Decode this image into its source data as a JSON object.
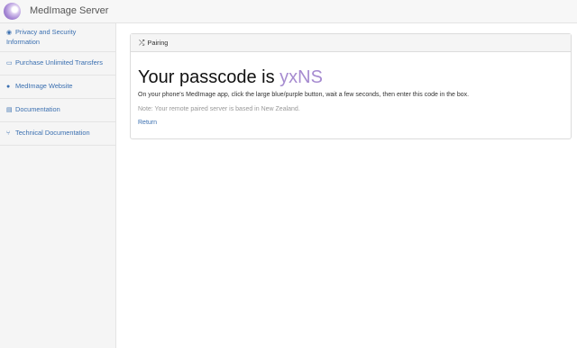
{
  "app": {
    "title": "MedImage Server"
  },
  "sidebar": {
    "items": [
      {
        "icon": "eye-icon",
        "label": "Privacy and Security Information"
      },
      {
        "icon": "credit-card-icon",
        "label": "Purchase Unlimited Transfers"
      },
      {
        "icon": "globe-icon",
        "label": "MedImage Website"
      },
      {
        "icon": "file-icon",
        "label": "Documentation"
      },
      {
        "icon": "code-fork-icon",
        "label": "Technical Documentation"
      }
    ]
  },
  "panel": {
    "header_icon": "shuffle-icon",
    "header": "Pairing",
    "passcode_prefix": "Your passcode is ",
    "passcode": "yxNS",
    "instructions": "On your phone's MedImage app, click the large blue/purple button, wait a few seconds, then enter this code in the box.",
    "note": "Note: Your remote paired server is based in New Zealand.",
    "return_label": "Return"
  },
  "colors": {
    "accent": "#a68bd0",
    "link": "#3a6fb0"
  }
}
